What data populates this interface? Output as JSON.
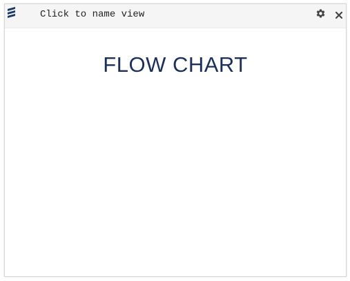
{
  "header": {
    "title": "Click to name view",
    "logo_icon": "stacked-layers-icon",
    "settings_icon": "gear-icon",
    "close_icon": "close-icon"
  },
  "content": {
    "title": "FLOW CHART"
  },
  "colors": {
    "logo": "#1b3a6b",
    "title_text": "#1b2f58",
    "header_bg": "#f5f5f5",
    "icon": "#444444"
  }
}
